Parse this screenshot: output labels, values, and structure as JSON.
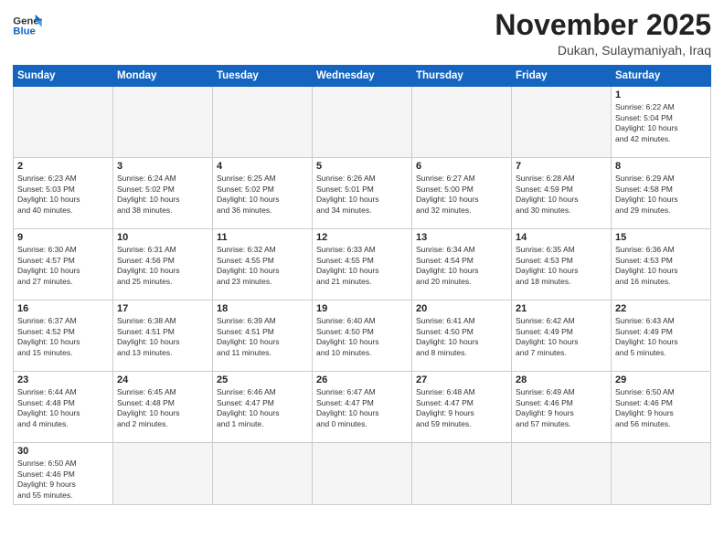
{
  "logo": {
    "line1": "General",
    "line2": "Blue"
  },
  "header": {
    "month_year": "November 2025",
    "location": "Dukan, Sulaymaniyah, Iraq"
  },
  "weekdays": [
    "Sunday",
    "Monday",
    "Tuesday",
    "Wednesday",
    "Thursday",
    "Friday",
    "Saturday"
  ],
  "weeks": [
    [
      {
        "day": "",
        "info": ""
      },
      {
        "day": "",
        "info": ""
      },
      {
        "day": "",
        "info": ""
      },
      {
        "day": "",
        "info": ""
      },
      {
        "day": "",
        "info": ""
      },
      {
        "day": "",
        "info": ""
      },
      {
        "day": "1",
        "info": "Sunrise: 6:22 AM\nSunset: 5:04 PM\nDaylight: 10 hours\nand 42 minutes."
      }
    ],
    [
      {
        "day": "2",
        "info": "Sunrise: 6:23 AM\nSunset: 5:03 PM\nDaylight: 10 hours\nand 40 minutes."
      },
      {
        "day": "3",
        "info": "Sunrise: 6:24 AM\nSunset: 5:02 PM\nDaylight: 10 hours\nand 38 minutes."
      },
      {
        "day": "4",
        "info": "Sunrise: 6:25 AM\nSunset: 5:02 PM\nDaylight: 10 hours\nand 36 minutes."
      },
      {
        "day": "5",
        "info": "Sunrise: 6:26 AM\nSunset: 5:01 PM\nDaylight: 10 hours\nand 34 minutes."
      },
      {
        "day": "6",
        "info": "Sunrise: 6:27 AM\nSunset: 5:00 PM\nDaylight: 10 hours\nand 32 minutes."
      },
      {
        "day": "7",
        "info": "Sunrise: 6:28 AM\nSunset: 4:59 PM\nDaylight: 10 hours\nand 30 minutes."
      },
      {
        "day": "8",
        "info": "Sunrise: 6:29 AM\nSunset: 4:58 PM\nDaylight: 10 hours\nand 29 minutes."
      }
    ],
    [
      {
        "day": "9",
        "info": "Sunrise: 6:30 AM\nSunset: 4:57 PM\nDaylight: 10 hours\nand 27 minutes."
      },
      {
        "day": "10",
        "info": "Sunrise: 6:31 AM\nSunset: 4:56 PM\nDaylight: 10 hours\nand 25 minutes."
      },
      {
        "day": "11",
        "info": "Sunrise: 6:32 AM\nSunset: 4:55 PM\nDaylight: 10 hours\nand 23 minutes."
      },
      {
        "day": "12",
        "info": "Sunrise: 6:33 AM\nSunset: 4:55 PM\nDaylight: 10 hours\nand 21 minutes."
      },
      {
        "day": "13",
        "info": "Sunrise: 6:34 AM\nSunset: 4:54 PM\nDaylight: 10 hours\nand 20 minutes."
      },
      {
        "day": "14",
        "info": "Sunrise: 6:35 AM\nSunset: 4:53 PM\nDaylight: 10 hours\nand 18 minutes."
      },
      {
        "day": "15",
        "info": "Sunrise: 6:36 AM\nSunset: 4:53 PM\nDaylight: 10 hours\nand 16 minutes."
      }
    ],
    [
      {
        "day": "16",
        "info": "Sunrise: 6:37 AM\nSunset: 4:52 PM\nDaylight: 10 hours\nand 15 minutes."
      },
      {
        "day": "17",
        "info": "Sunrise: 6:38 AM\nSunset: 4:51 PM\nDaylight: 10 hours\nand 13 minutes."
      },
      {
        "day": "18",
        "info": "Sunrise: 6:39 AM\nSunset: 4:51 PM\nDaylight: 10 hours\nand 11 minutes."
      },
      {
        "day": "19",
        "info": "Sunrise: 6:40 AM\nSunset: 4:50 PM\nDaylight: 10 hours\nand 10 minutes."
      },
      {
        "day": "20",
        "info": "Sunrise: 6:41 AM\nSunset: 4:50 PM\nDaylight: 10 hours\nand 8 minutes."
      },
      {
        "day": "21",
        "info": "Sunrise: 6:42 AM\nSunset: 4:49 PM\nDaylight: 10 hours\nand 7 minutes."
      },
      {
        "day": "22",
        "info": "Sunrise: 6:43 AM\nSunset: 4:49 PM\nDaylight: 10 hours\nand 5 minutes."
      }
    ],
    [
      {
        "day": "23",
        "info": "Sunrise: 6:44 AM\nSunset: 4:48 PM\nDaylight: 10 hours\nand 4 minutes."
      },
      {
        "day": "24",
        "info": "Sunrise: 6:45 AM\nSunset: 4:48 PM\nDaylight: 10 hours\nand 2 minutes."
      },
      {
        "day": "25",
        "info": "Sunrise: 6:46 AM\nSunset: 4:47 PM\nDaylight: 10 hours\nand 1 minute."
      },
      {
        "day": "26",
        "info": "Sunrise: 6:47 AM\nSunset: 4:47 PM\nDaylight: 10 hours\nand 0 minutes."
      },
      {
        "day": "27",
        "info": "Sunrise: 6:48 AM\nSunset: 4:47 PM\nDaylight: 9 hours\nand 59 minutes."
      },
      {
        "day": "28",
        "info": "Sunrise: 6:49 AM\nSunset: 4:46 PM\nDaylight: 9 hours\nand 57 minutes."
      },
      {
        "day": "29",
        "info": "Sunrise: 6:50 AM\nSunset: 4:46 PM\nDaylight: 9 hours\nand 56 minutes."
      }
    ],
    [
      {
        "day": "30",
        "info": "Sunrise: 6:50 AM\nSunset: 4:46 PM\nDaylight: 9 hours\nand 55 minutes."
      },
      {
        "day": "",
        "info": ""
      },
      {
        "day": "",
        "info": ""
      },
      {
        "day": "",
        "info": ""
      },
      {
        "day": "",
        "info": ""
      },
      {
        "day": "",
        "info": ""
      },
      {
        "day": "",
        "info": ""
      }
    ]
  ]
}
